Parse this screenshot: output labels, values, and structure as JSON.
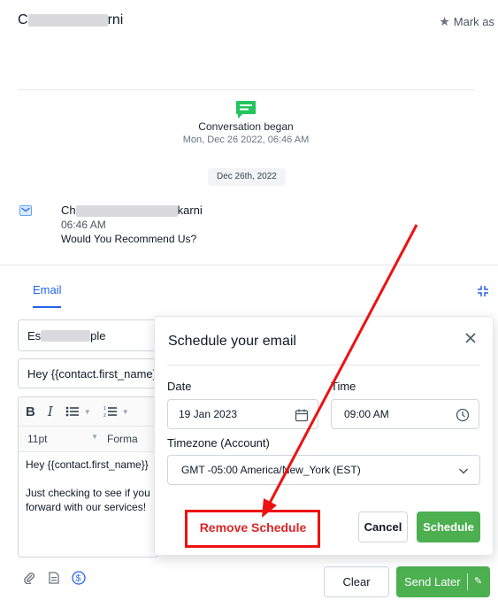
{
  "header": {
    "name_prefix": "C",
    "name_suffix": "rni",
    "mark_as_label": "Mark as"
  },
  "conversation": {
    "began_label": "Conversation began",
    "began_time": "Mon, Dec 26 2022, 06:46 AM",
    "date_chip": "Dec 26th, 2022"
  },
  "message": {
    "sender_prefix": "Ch",
    "sender_suffix": "karni",
    "time": "06:46 AM",
    "text": "Would You Recommend Us?"
  },
  "compose": {
    "tab_email": "Email",
    "from_prefix": "Es",
    "from_suffix": "ple",
    "subject_value": "Hey {{contact.first_name}",
    "font_size": "11pt",
    "format_label": "Forma",
    "body_line1": "Hey {{contact.first_name}}",
    "body_line2": "Just checking to see if you",
    "body_line3": "forward with our services!",
    "clear_label": "Clear",
    "send_later_label": "Send Later"
  },
  "modal": {
    "title": "Schedule your email",
    "date_label": "Date",
    "date_value": "19 Jan 2023",
    "time_label": "Time",
    "time_value": "09:00 AM",
    "timezone_label": "Timezone (Account)",
    "timezone_value": "GMT -05:00 America/New_York (EST)",
    "remove_label": "Remove Schedule",
    "cancel_label": "Cancel",
    "schedule_label": "Schedule"
  },
  "colors": {
    "accent_blue": "#2563eb",
    "green": "#4caf50",
    "annotation_red": "#e11111",
    "remove_red": "#dc2626"
  }
}
